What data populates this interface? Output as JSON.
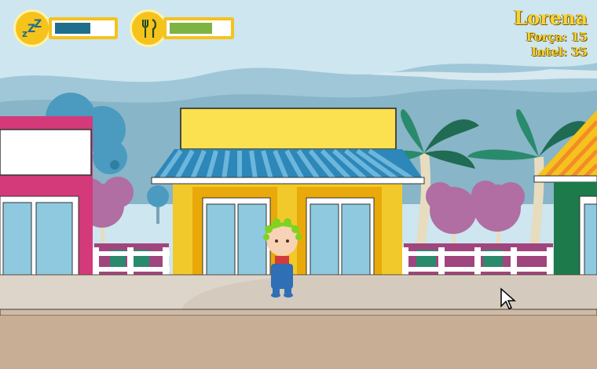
{
  "hud": {
    "sleep": {
      "icon": "sleep-zzz-icon",
      "level": 0.62,
      "color": "#1d6f8c"
    },
    "hunger": {
      "icon": "fork-knife-icon",
      "level": 0.73,
      "color": "#7cb342"
    }
  },
  "player": {
    "name": "Lorena",
    "forca_label": "Força: 15",
    "intel_label": "Intel: 35"
  },
  "colors": {
    "accent": "#f6c21c",
    "sky": "#cde6ef",
    "shop_yellow": "#f2c92a",
    "shop_pink": "#d43a7a",
    "shop_green": "#1d7a4a"
  }
}
